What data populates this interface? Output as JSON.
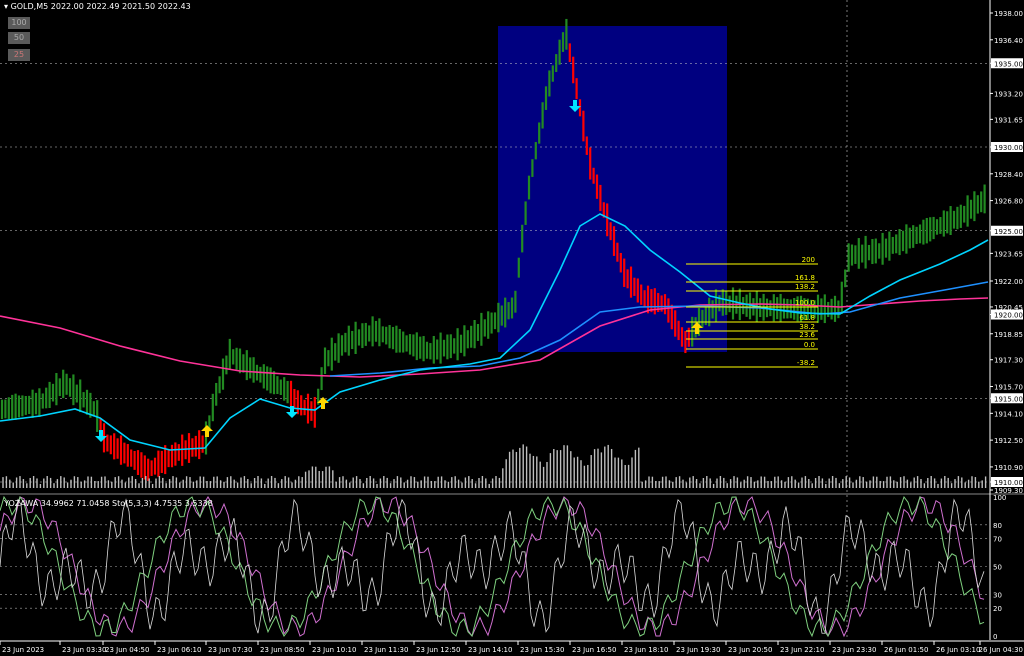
{
  "header": {
    "symbol_label": "GOLD,M5",
    "ohlc": "2022.00 2022.49 2021.50 2022.43",
    "buttons": [
      "100",
      "50",
      "25"
    ]
  },
  "indicator": {
    "label": "YOZAWA 34.9962 71.0458  Sto(5,3,3) 4.7535 3.5338"
  },
  "price_axis": {
    "labels": [
      "1938.00",
      "1936.40",
      "1935.00",
      "1933.20",
      "1931.65",
      "1930.00",
      "1928.40",
      "1926.80",
      "1925.00",
      "1923.65",
      "1922.00",
      "1920.45",
      "1920.00",
      "1918.85",
      "1917.30",
      "1915.70",
      "1915.00",
      "1914.10",
      "1912.50",
      "1910.90",
      "1910.00",
      "1909.30"
    ],
    "highlighted": [
      "1935.00",
      "1930.00",
      "1925.00",
      "1920.00",
      "1915.00",
      "1910.00"
    ]
  },
  "stoch_axis": {
    "labels": [
      "100",
      "80",
      "70",
      "50",
      "30",
      "20",
      "0"
    ]
  },
  "time_axis": {
    "labels": [
      "23 Jun 2023",
      "23 Jun 03:30",
      "23 Jun 04:50",
      "23 Jun 06:10",
      "23 Jun 07:30",
      "23 Jun 08:50",
      "23 Jun 10:10",
      "23 Jun 11:30",
      "23 Jun 12:50",
      "23 Jun 14:10",
      "23 Jun 15:30",
      "23 Jun 16:50",
      "23 Jun 18:10",
      "23 Jun 19:30",
      "23 Jun 20:50",
      "23 Jun 22:10",
      "23 Jun 23:30",
      "26 Jun 01:50",
      "26 Jun 03:10",
      "26 Jun 04:30"
    ]
  },
  "fibonacci": {
    "levels": [
      "200",
      "161.8",
      "138.2",
      "100.0",
      "61.8",
      "38.2",
      "23.6",
      "0.0",
      "-38.2"
    ]
  },
  "colors": {
    "background": "#000000",
    "bull_candle": "#228b22",
    "bear_candle": "#ff0000",
    "fast_ma": "#00d4ff",
    "slow_ma": "#1e90ff",
    "long_ma": "#ff3399",
    "rectangle": "#000080",
    "fibo": "#ffff00",
    "arrow_up": "#ffd700",
    "arrow_down": "#00e5ff",
    "volume": "#bfbfbf"
  }
}
